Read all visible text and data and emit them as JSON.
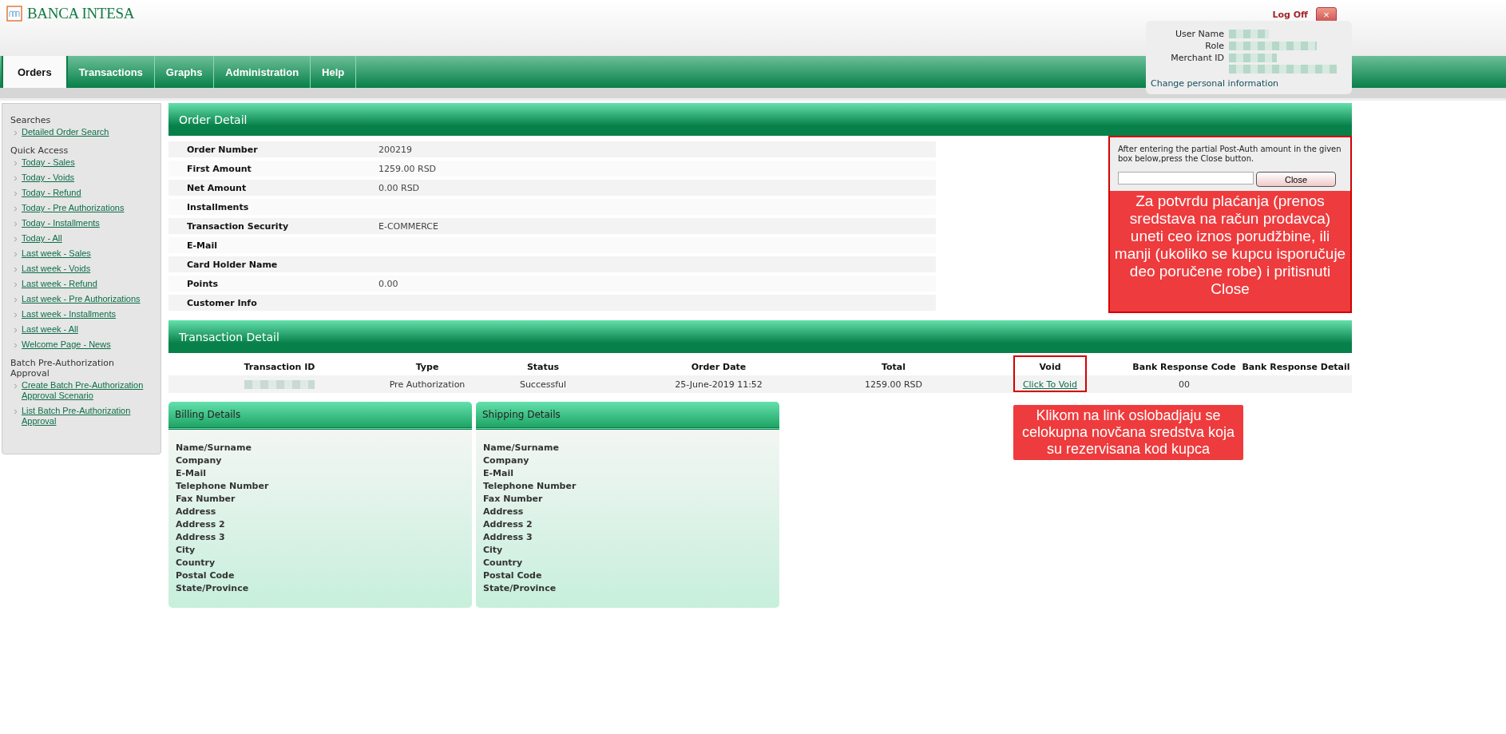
{
  "header": {
    "logo_text": "BANCA INTESA",
    "logoff": "Log Off",
    "logoff_button": "×"
  },
  "user_panel": {
    "fields": [
      {
        "label": "User Name"
      },
      {
        "label": "Role"
      },
      {
        "label": "Merchant ID"
      }
    ],
    "link": "Change personal information"
  },
  "tabs": [
    {
      "label": "Orders",
      "selected": true
    },
    {
      "label": "Transactions",
      "selected": false
    },
    {
      "label": "Graphs",
      "selected": false
    },
    {
      "label": "Administration",
      "selected": false
    },
    {
      "label": "Help",
      "selected": false
    }
  ],
  "sidebar": {
    "sections": [
      {
        "title": "Searches",
        "items": [
          "Detailed Order Search"
        ]
      },
      {
        "title": "Quick Access",
        "items": [
          "Today - Sales",
          "Today - Voids",
          "Today - Refund",
          "Today - Pre Authorizations",
          "Today - Installments",
          "Today - All",
          "Last week - Sales",
          "Last week - Voids",
          "Last week - Refund",
          "Last week - Pre Authorizations",
          "Last week - Installments",
          "Last week - All",
          "Welcome Page - News"
        ]
      },
      {
        "title": "Batch Pre-Authorization Approval",
        "items": [
          "Create Batch Pre-Authorization Approval Scenario",
          "List Batch Pre-Authorization Approval"
        ]
      }
    ]
  },
  "order_detail": {
    "title": "Order Detail",
    "rows": [
      {
        "label": "Order Number",
        "value": "200219"
      },
      {
        "label": "First Amount",
        "value": "1259.00 RSD"
      },
      {
        "label": "Net Amount",
        "value": "0.00 RSD"
      },
      {
        "label": "Installments"
      },
      {
        "label": "Transaction Security",
        "value": "E-COMMERCE"
      },
      {
        "label": "E-Mail"
      },
      {
        "label": "Card Holder Name"
      },
      {
        "label": "Points",
        "value": "0.00"
      },
      {
        "label": "Customer Info"
      }
    ]
  },
  "post_auth": {
    "instruction": "After entering the partial Post-Auth amount in the given box below,press the Close button.",
    "button": "Close",
    "note": "Za potvrdu plaćanja (prenos sredstava na račun prodavca) uneti ceo iznos porudžbine, ili manji (ukoliko se kupcu isporučuje deo poručene robe) i pritisnuti Close"
  },
  "transaction_detail": {
    "title": "Transaction Detail",
    "columns": [
      "Transaction ID",
      "Type",
      "Status",
      "Order Date",
      "Total",
      "Void",
      "Bank Response Code",
      "Bank Response Detail"
    ],
    "rows": [
      {
        "cells": [
          {
            "kind": "redacted"
          },
          {
            "kind": "text",
            "text": "Pre Authorization"
          },
          {
            "kind": "text",
            "text": "Successful"
          },
          {
            "kind": "text",
            "text": "25-June-2019 11:52"
          },
          {
            "kind": "text",
            "text": "1259.00 RSD"
          },
          {
            "kind": "link",
            "text": "Click To Void"
          },
          {
            "kind": "text",
            "text": "00"
          },
          {
            "kind": "empty"
          }
        ]
      }
    ],
    "void_note": "Klikom na link oslobadjaju se celokupna novčana sredstva koja su rezervisana kod kupca"
  },
  "address_panels": [
    {
      "title": "Billing Details",
      "fields": [
        "Name/Surname",
        "Company",
        "E-Mail",
        "Telephone Number",
        "Fax Number",
        "Address",
        "Address 2",
        "Address 3",
        "City",
        "Country",
        "Postal Code",
        "State/Province"
      ]
    },
    {
      "title": "Shipping Details",
      "fields": [
        "Name/Surname",
        "Company",
        "E-Mail",
        "Telephone Number",
        "Fax Number",
        "Address",
        "Address 2",
        "Address 3",
        "City",
        "Country",
        "Postal Code",
        "State/Province"
      ]
    }
  ]
}
